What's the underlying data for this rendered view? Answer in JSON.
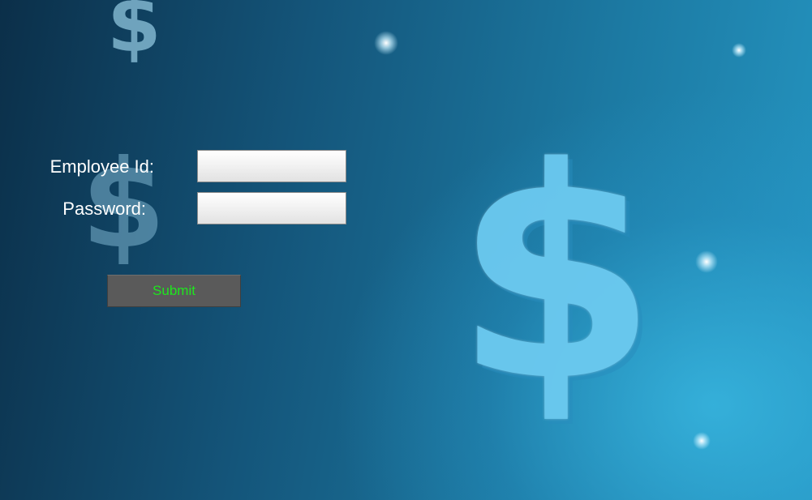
{
  "background": {
    "theme_color": "#1c7aa3",
    "decor_icons": [
      "dollar-icon",
      "dollar-icon",
      "dollar-icon"
    ]
  },
  "form": {
    "employee_id_label": "Employee Id:",
    "employee_id_value": "",
    "password_label": "Password:",
    "password_value": "",
    "submit_label": "Submit",
    "submit_text_color": "#1ee61e"
  }
}
